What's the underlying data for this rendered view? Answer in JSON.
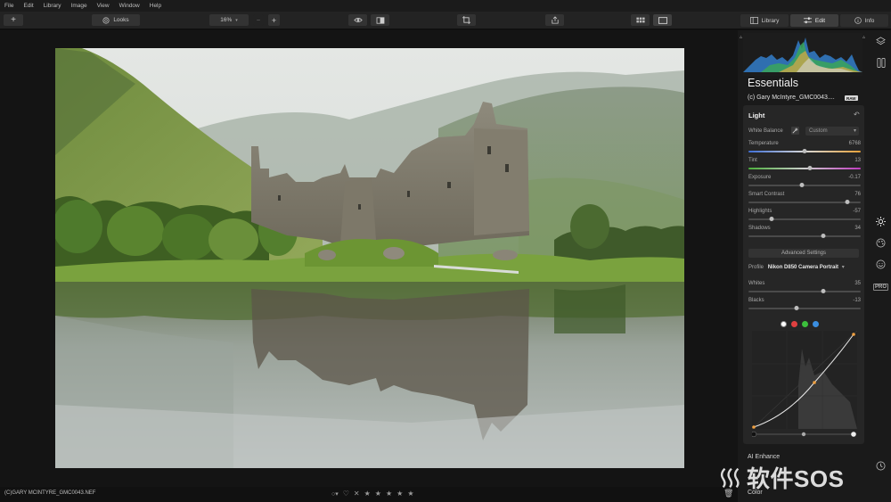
{
  "menu": [
    "File",
    "Edit",
    "Library",
    "Image",
    "View",
    "Window",
    "Help"
  ],
  "toolbar": {
    "add_label": "+",
    "looks_label": "Looks",
    "zoom_value": "16%",
    "zoom_minus": "–",
    "zoom_plus": "+"
  },
  "tabs": {
    "library": "Library",
    "edit": "Edit",
    "info": "Info"
  },
  "status": {
    "filename": "(C)GARY MCINTYRE_GMC0043.NEF",
    "stars": [
      "★",
      "★",
      "★",
      "★",
      "★"
    ]
  },
  "panel": {
    "title": "Essentials",
    "file": "(c) Gary McIntyre_GMC0043....",
    "raw_badge": "RAW",
    "light": {
      "header": "Light",
      "white_balance_label": "White Balance",
      "white_balance_value": "Custom",
      "sliders": [
        {
          "label": "Temperature",
          "value": "6768",
          "pos": 0.5
        },
        {
          "label": "Tint",
          "value": "13",
          "pos": 0.55
        },
        {
          "label": "Exposure",
          "value": "-0.17",
          "pos": 0.48
        },
        {
          "label": "Smart Contrast",
          "value": "76",
          "pos": 0.88
        },
        {
          "label": "Highlights",
          "value": "-57",
          "pos": 0.21
        },
        {
          "label": "Shadows",
          "value": "34",
          "pos": 0.67
        }
      ],
      "advanced_settings": "Advanced Settings",
      "profile_label": "Profile",
      "profile_value": "Nikon D850 Camera Portrait",
      "sliders2": [
        {
          "label": "Whites",
          "value": "35",
          "pos": 0.67
        },
        {
          "label": "Blacks",
          "value": "-13",
          "pos": 0.43
        }
      ],
      "curve_channel_colors": [
        "#ffffff",
        "#e04040",
        "#3cbf3c",
        "#3b8ee0"
      ]
    },
    "ai_enhance": "AI Enhance",
    "color": "Color"
  },
  "watermark": "软件SOS",
  "colors": {
    "panel_bg": "#1a1a1a",
    "card_bg": "#262626",
    "accent": "#f0a040"
  }
}
